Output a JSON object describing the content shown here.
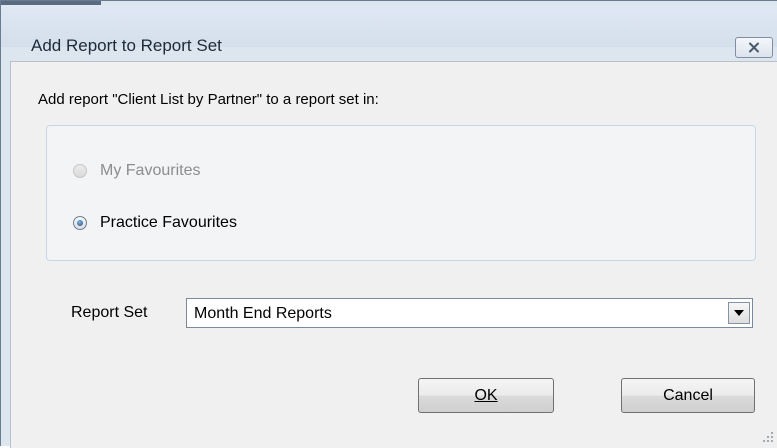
{
  "window": {
    "title": "Add Report to Report Set"
  },
  "dialog": {
    "prompt": "Add report \"Client List by Partner\" to a report set in:",
    "options": [
      {
        "label": "My Favourites",
        "state": "disabled",
        "selected": false
      },
      {
        "label": "Practice Favourites",
        "state": "enabled",
        "selected": true
      }
    ],
    "report_set_label": "Report Set",
    "report_set_value": "Month End Reports"
  },
  "buttons": {
    "ok_label": "OK",
    "cancel_label": "Cancel"
  },
  "icons": {
    "close": "close-icon",
    "dropdown": "chevron-down-icon",
    "resize": "resize-grip-icon"
  },
  "colors": {
    "titlebar": "#d9e3ef",
    "client_bg": "#f0f0f0",
    "disabled_text": "#8d8d8d",
    "radio_selected": "#1b4f8a"
  }
}
